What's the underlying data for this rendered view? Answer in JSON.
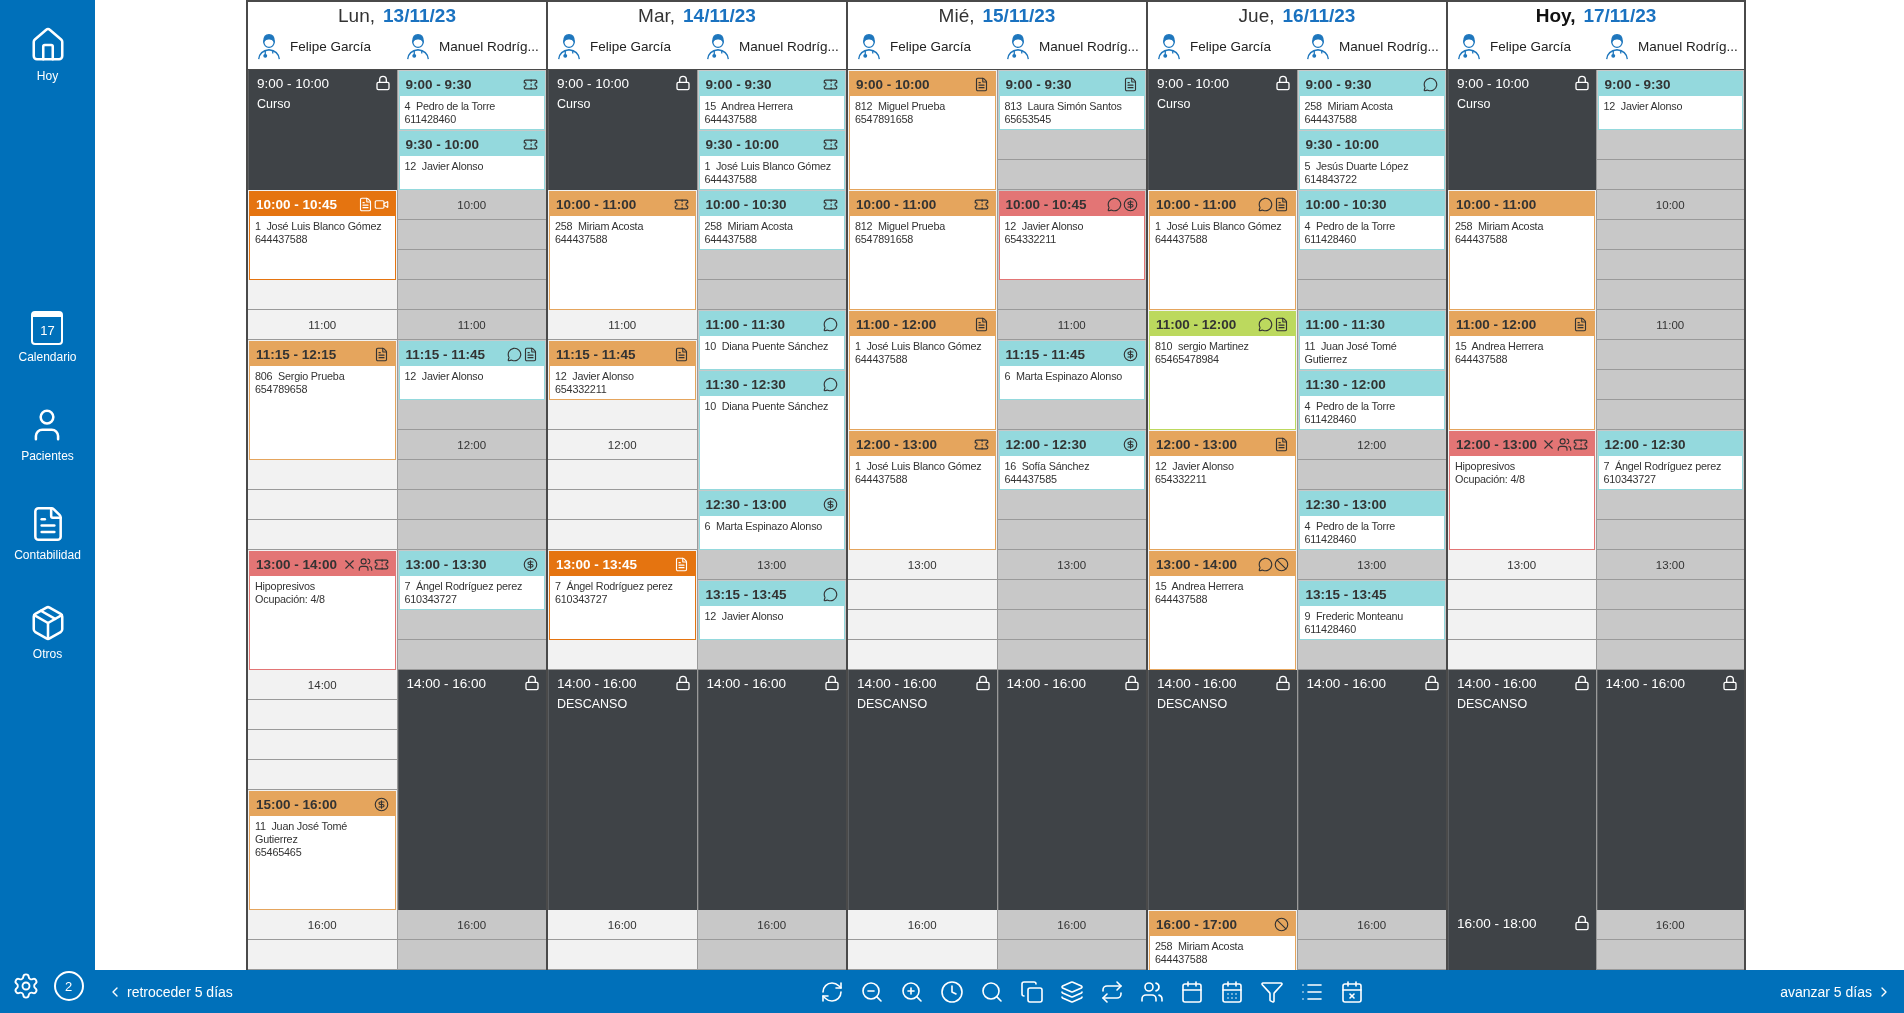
{
  "sidebar": {
    "items": [
      {
        "label": "Hoy"
      },
      {
        "label": "Calendario",
        "badge": "17"
      },
      {
        "label": "Pacientes"
      },
      {
        "label": "Contabilidad"
      },
      {
        "label": "Otros"
      }
    ],
    "notifications": "2"
  },
  "days": [
    {
      "weekday": "Lun,",
      "date": "13/11/23",
      "today": false,
      "columns": [
        {
          "staff": "Felipe García",
          "available": true,
          "hour_labels": [
            "11:00",
            "14:00",
            "16:00"
          ],
          "events": [
            {
              "kind": "blocked",
              "time": "9:00 - 10:00",
              "title": "Curso"
            },
            {
              "kind": "appointment",
              "time": "10:00 - 10:45",
              "color": "#e57410",
              "invoice": true,
              "video": true,
              "patient": "1  José Luis Blanco Gómez",
              "phone": "644437588"
            },
            {
              "kind": "appointment",
              "time": "11:15 - 12:15",
              "color": "#e5a55d",
              "invoice": true,
              "patient": "806  Sergio Prueba",
              "phone": "654789658"
            },
            {
              "kind": "group",
              "time": "13:00 - 14:00",
              "color": "#e37575",
              "cancelled": true,
              "group": true,
              "voucher": true,
              "title": "Hipopresivos",
              "occupancy": "Ocupación: 4/8"
            },
            {
              "kind": "appointment",
              "time": "15:00 - 16:00",
              "color": "#e5a55d",
              "paid": true,
              "patient": "11  Juan José Tomé Gutierrez",
              "phone": "65465465"
            }
          ]
        },
        {
          "staff": "Manuel Rodríg...",
          "available": false,
          "hour_labels": [
            "10:00",
            "11:00",
            "12:00",
            "16:00"
          ],
          "events": [
            {
              "kind": "appointment",
              "time": "9:00 - 9:30",
              "color": "#94d9dd",
              "voucher": true,
              "patient": "4  Pedro de la Torre",
              "phone": "611428460"
            },
            {
              "kind": "appointment",
              "time": "9:30 - 10:00",
              "color": "#94d9dd",
              "voucher": true,
              "patient": "12  Javier Alonso"
            },
            {
              "kind": "appointment",
              "time": "11:15 - 11:45",
              "color": "#94d9dd",
              "note": true,
              "invoice": true,
              "patient": "12  Javier Alonso"
            },
            {
              "kind": "appointment",
              "time": "13:00 - 13:30",
              "color": "#94d9dd",
              "paid": true,
              "patient": "7  Ángel Rodríguez perez",
              "phone": "610343727"
            },
            {
              "kind": "blocked",
              "time": "14:00 - 16:00"
            }
          ]
        }
      ]
    },
    {
      "weekday": "Mar,",
      "date": "14/11/23",
      "today": false,
      "columns": [
        {
          "staff": "Felipe García",
          "available": true,
          "hour_labels": [
            "11:00",
            "12:00",
            "16:00"
          ],
          "events": [
            {
              "kind": "blocked",
              "time": "9:00 - 10:00",
              "title": "Curso"
            },
            {
              "kind": "appointment",
              "time": "10:00 - 11:00",
              "color": "#e5a55d",
              "voucher": true,
              "patient": "258  Miriam Acosta",
              "phone": "644437588"
            },
            {
              "kind": "appointment",
              "time": "11:15 - 11:45",
              "color": "#e5a55d",
              "invoice": true,
              "patient": "12  Javier Alonso",
              "phone": "654332211"
            },
            {
              "kind": "appointment",
              "time": "13:00 - 13:45",
              "color": "#e57410",
              "invoice": true,
              "patient": "7  Ángel Rodríguez perez",
              "phone": "610343727"
            },
            {
              "kind": "blocked",
              "time": "14:00 - 16:00",
              "title": "DESCANSO"
            }
          ]
        },
        {
          "staff": "Manuel Rodríg...",
          "available": false,
          "hour_labels": [
            "13:00",
            "16:00"
          ],
          "events": [
            {
              "kind": "appointment",
              "time": "9:00 - 9:30",
              "color": "#94d9dd",
              "voucher": true,
              "patient": "15  Andrea Herrera",
              "phone": "644437588"
            },
            {
              "kind": "appointment",
              "time": "9:30 - 10:00",
              "color": "#94d9dd",
              "voucher": true,
              "patient": "1  José Luis Blanco Gómez",
              "phone": "644437588"
            },
            {
              "kind": "appointment",
              "time": "10:00 - 10:30",
              "color": "#94d9dd",
              "voucher": true,
              "patient": "258  Miriam Acosta",
              "phone": "644437588"
            },
            {
              "kind": "appointment",
              "time": "11:00 - 11:30",
              "color": "#94d9dd",
              "note": true,
              "patient": "10  Diana Puente Sánchez"
            },
            {
              "kind": "appointment",
              "time": "11:30 - 12:30",
              "color": "#94d9dd",
              "note": true,
              "patient": "10  Diana Puente Sánchez"
            },
            {
              "kind": "appointment",
              "time": "12:30 - 13:00",
              "color": "#94d9dd",
              "paid": true,
              "patient": "6  Marta Espinazo Alonso"
            },
            {
              "kind": "appointment",
              "time": "13:15 - 13:45",
              "color": "#94d9dd",
              "note": true,
              "patient": "12  Javier Alonso"
            },
            {
              "kind": "blocked",
              "time": "14:00 - 16:00"
            }
          ]
        }
      ]
    },
    {
      "weekday": "Mié,",
      "date": "15/11/23",
      "today": false,
      "columns": [
        {
          "staff": "Felipe García",
          "available": true,
          "hour_labels": [
            "13:00",
            "16:00"
          ],
          "events": [
            {
              "kind": "appointment",
              "time": "9:00 - 10:00",
              "color": "#e5a55d",
              "invoice": true,
              "patient": "812  Miguel Prueba",
              "phone": "6547891658"
            },
            {
              "kind": "appointment",
              "time": "10:00 - 11:00",
              "color": "#e5a55d",
              "voucher": true,
              "patient": "812  Miguel Prueba",
              "phone": "6547891658"
            },
            {
              "kind": "appointment",
              "time": "11:00 - 12:00",
              "color": "#e5a55d",
              "invoice": true,
              "patient": "1  José Luis Blanco Gómez",
              "phone": "644437588"
            },
            {
              "kind": "appointment",
              "time": "12:00 - 13:00",
              "color": "#e5a55d",
              "voucher": true,
              "patient": "1  José Luis Blanco Gómez",
              "phone": "644437588"
            },
            {
              "kind": "blocked",
              "time": "14:00 - 16:00",
              "title": "DESCANSO"
            }
          ]
        },
        {
          "staff": "Manuel Rodríg...",
          "available": false,
          "hour_labels": [
            "11:00",
            "13:00",
            "16:00"
          ],
          "events": [
            {
              "kind": "appointment",
              "time": "9:00 - 9:30",
              "color": "#94d9dd",
              "invoice": true,
              "patient": "813  Laura Simón Santos",
              "phone": "65653545"
            },
            {
              "kind": "appointment",
              "time": "10:00 - 10:45",
              "color": "#e37575",
              "note": true,
              "paid": true,
              "patient": "12  Javier Alonso",
              "phone": "654332211"
            },
            {
              "kind": "appointment",
              "time": "11:15 - 11:45",
              "color": "#94d9dd",
              "paid": true,
              "patient": "6  Marta Espinazo Alonso"
            },
            {
              "kind": "appointment",
              "time": "12:00 - 12:30",
              "color": "#94d9dd",
              "paid": true,
              "patient": "16  Sofía Sánchez",
              "phone": "644437585"
            },
            {
              "kind": "blocked",
              "time": "14:00 - 16:00"
            }
          ]
        }
      ]
    },
    {
      "weekday": "Jue,",
      "date": "16/11/23",
      "today": false,
      "columns": [
        {
          "staff": "Felipe García",
          "available": true,
          "events": [
            {
              "kind": "blocked",
              "time": "9:00 - 10:00",
              "title": "Curso"
            },
            {
              "kind": "appointment",
              "time": "10:00 - 11:00",
              "color": "#e5a55d",
              "note": true,
              "invoice": true,
              "patient": "1  José Luis Blanco Gómez",
              "phone": "644437588"
            },
            {
              "kind": "appointment",
              "time": "11:00 - 12:00",
              "color": "#bcd95e",
              "note": true,
              "invoice": true,
              "patient": "810  sergio Martinez",
              "phone": "65465478984"
            },
            {
              "kind": "appointment",
              "time": "12:00 - 13:00",
              "color": "#e5a55d",
              "invoice": true,
              "patient": "12  Javier Alonso",
              "phone": "654332211"
            },
            {
              "kind": "appointment",
              "time": "13:00 - 14:00",
              "color": "#e5a55d",
              "note": true,
              "no_show": true,
              "patient": "15  Andrea Herrera",
              "phone": "644437588"
            },
            {
              "kind": "blocked",
              "time": "14:00 - 16:00",
              "title": "DESCANSO"
            },
            {
              "kind": "appointment",
              "time": "16:00 - 17:00",
              "color": "#e5a55d",
              "no_show": true,
              "patient": "258  Miriam Acosta",
              "phone": "644437588"
            }
          ]
        },
        {
          "staff": "Manuel Rodríg...",
          "available": false,
          "hour_labels": [
            "12:00",
            "13:00",
            "16:00"
          ],
          "events": [
            {
              "kind": "appointment",
              "time": "9:00 - 9:30",
              "color": "#94d9dd",
              "note": true,
              "patient": "258  Miriam Acosta",
              "phone": "644437588"
            },
            {
              "kind": "appointment",
              "time": "9:30 - 10:00",
              "color": "#94d9dd",
              "patient": "5  Jesús Duarte López",
              "phone": "614843722"
            },
            {
              "kind": "appointment",
              "time": "10:00 - 10:30",
              "color": "#94d9dd",
              "patient": "4  Pedro de la Torre",
              "phone": "611428460"
            },
            {
              "kind": "appointment",
              "time": "11:00 - 11:30",
              "color": "#94d9dd",
              "patient": "11  Juan José Tomé Gutierrez"
            },
            {
              "kind": "appointment",
              "time": "11:30 - 12:00",
              "color": "#94d9dd",
              "patient": "4  Pedro de la Torre",
              "phone": "611428460"
            },
            {
              "kind": "appointment",
              "time": "12:30 - 13:00",
              "color": "#94d9dd",
              "patient": "4  Pedro de la Torre",
              "phone": "611428460"
            },
            {
              "kind": "appointment",
              "time": "13:15 - 13:45",
              "color": "#94d9dd",
              "patient": "9  Frederic Monteanu",
              "phone": "611428460"
            },
            {
              "kind": "blocked",
              "time": "14:00 - 16:00"
            }
          ]
        }
      ]
    },
    {
      "weekday": "Hoy,",
      "date": "17/11/23",
      "today": true,
      "columns": [
        {
          "staff": "Felipe García",
          "available": true,
          "hour_labels": [
            "13:00"
          ],
          "events": [
            {
              "kind": "blocked",
              "time": "9:00 - 10:00",
              "title": "Curso"
            },
            {
              "kind": "appointment",
              "time": "10:00 - 11:00",
              "color": "#e5a55d",
              "patient": "258  Miriam Acosta",
              "phone": "644437588"
            },
            {
              "kind": "appointment",
              "time": "11:00 - 12:00",
              "color": "#e5a55d",
              "invoice": true,
              "patient": "15  Andrea Herrera",
              "phone": "644437588"
            },
            {
              "kind": "group",
              "time": "12:00 - 13:00",
              "color": "#e37575",
              "cancelled": true,
              "group": true,
              "voucher": true,
              "title": "Hipopresivos",
              "occupancy": "Ocupación: 4/8"
            },
            {
              "kind": "blocked",
              "time": "14:00 - 16:00",
              "title": "DESCANSO"
            },
            {
              "kind": "blocked",
              "time": "16:00 - 18:00"
            }
          ]
        },
        {
          "staff": "Manuel Rodríg...",
          "available": false,
          "hour_labels": [
            "10:00",
            "11:00",
            "13:00",
            "16:00"
          ],
          "events": [
            {
              "kind": "appointment",
              "time": "9:00 - 9:30",
              "color": "#94d9dd",
              "patient": "12  Javier Alonso"
            },
            {
              "kind": "appointment",
              "time": "12:00 - 12:30",
              "color": "#94d9dd",
              "patient": "7  Ángel Rodríguez perez",
              "phone": "610343727"
            },
            {
              "kind": "blocked",
              "time": "14:00 - 16:00"
            }
          ]
        }
      ]
    }
  ],
  "footer": {
    "back": "retroceder 5 días",
    "forward": "avanzar 5 días"
  }
}
